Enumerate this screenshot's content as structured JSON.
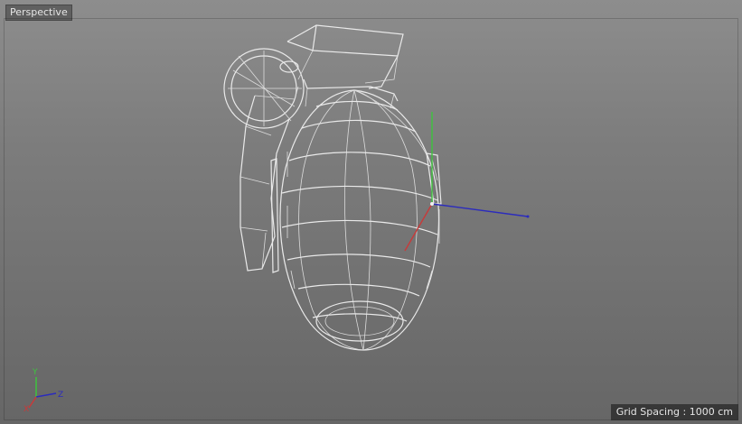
{
  "viewport": {
    "label": "Perspective",
    "grid_spacing": "Grid Spacing : 1000 cm"
  },
  "axes": {
    "x_label": "X",
    "y_label": "Y",
    "z_label": "Z",
    "x_color": "#c83a3a",
    "y_color": "#3ec43e",
    "z_color": "#2b2bbd"
  },
  "object": {
    "icon": "grenade-wireframe-icon"
  }
}
